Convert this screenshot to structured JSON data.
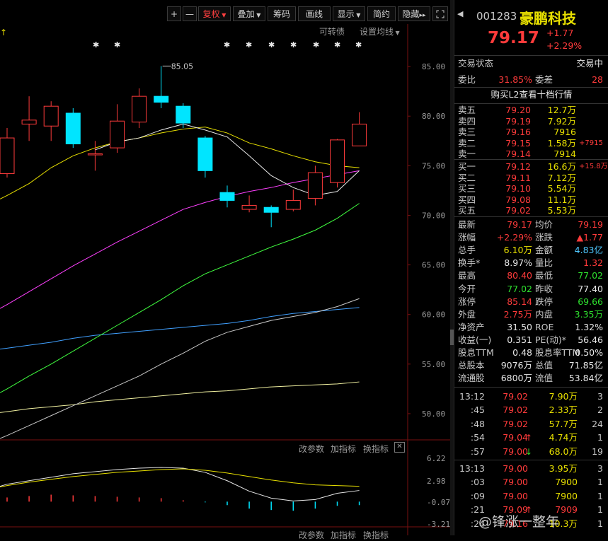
{
  "toolbar": {
    "plus": "+",
    "minus": "—",
    "fuquan": "复权",
    "diejia": "叠加",
    "chouma": "筹码",
    "huaxian": "画线",
    "xianshi": "显示",
    "jianyue": "简约",
    "yincang": "隐藏",
    "expand_icon": "expand-icon"
  },
  "chart": {
    "convertible": "可转债",
    "ma_settings": "设置均线",
    "high_marker": "85.05",
    "y_axis": [
      "85.00",
      "80.00",
      "75.00",
      "70.00",
      "65.00",
      "60.00",
      "55.00",
      "50.00"
    ],
    "sub_params": "改参数",
    "sub_add": "加指标",
    "sub_switch": "换指标",
    "sub_y_axis": [
      "6.22",
      "2.98",
      "-0.07",
      "-3.21"
    ],
    "bottom_params": "改参数",
    "bottom_add": "加指标",
    "bottom_switch": "换指标",
    "colors": {
      "up": "#ff3b3b",
      "down": "#00e5ff",
      "ma5": "#e8e8e8",
      "ma10": "#e8e000",
      "ma20": "#ff40ff",
      "ma30": "#40ff40",
      "ma60": "#c8c8c8",
      "ma120": "#40a0ff",
      "ma250": "#f0f0a0"
    }
  },
  "chart_data": {
    "type": "candlestick",
    "y_range": [
      47.5,
      88.5
    ],
    "candles": [
      {
        "o": 74.2,
        "c": 77.8,
        "h": 78.8,
        "l": 73.8
      },
      {
        "o": 79.2,
        "c": 79.6,
        "h": 82.0,
        "l": 77.5
      },
      {
        "o": 79.0,
        "c": 81.0,
        "h": 81.5,
        "l": 77.5
      },
      {
        "o": 80.3,
        "c": 77.2,
        "h": 80.8,
        "l": 76.8
      },
      {
        "o": 76.2,
        "c": 76.2,
        "h": 77.5,
        "l": 74.5
      },
      {
        "o": 76.8,
        "c": 79.5,
        "h": 81.2,
        "l": 76.3
      },
      {
        "o": 79.4,
        "c": 82.0,
        "h": 82.8,
        "l": 78.8
      },
      {
        "o": 82.0,
        "c": 81.4,
        "h": 85.05,
        "l": 80.8
      },
      {
        "o": 81.0,
        "c": 79.3,
        "h": 81.3,
        "l": 78.8
      },
      {
        "o": 77.8,
        "c": 74.5,
        "h": 78.0,
        "l": 73.8
      },
      {
        "o": 72.3,
        "c": 71.5,
        "h": 73.0,
        "l": 70.8
      },
      {
        "o": 70.6,
        "c": 71.0,
        "h": 72.0,
        "l": 70.3
      },
      {
        "o": 70.8,
        "c": 70.3,
        "h": 71.0,
        "l": 68.8
      },
      {
        "o": 70.6,
        "c": 71.5,
        "h": 72.6,
        "l": 70.4
      },
      {
        "o": 71.7,
        "c": 74.3,
        "h": 75.0,
        "l": 71.0
      },
      {
        "o": 73.3,
        "c": 77.6,
        "h": 77.7,
        "l": 72.8
      },
      {
        "o": 77.0,
        "c": 79.2,
        "h": 80.4,
        "l": 77.0
      }
    ],
    "ma5": [
      null,
      null,
      null,
      null,
      76.6,
      77.4,
      77.8,
      78.6,
      79.2,
      78.6,
      77.9,
      76.0,
      74.0,
      72.8,
      72.0,
      72.4,
      74.5
    ],
    "ma10": [
      72.0,
      73.2,
      74.8,
      76.0,
      76.8,
      77.4,
      77.8,
      78.3,
      78.7,
      78.9,
      78.3,
      77.3,
      76.7,
      76.0,
      75.4,
      75.0,
      74.8
    ],
    "ma20": [
      61.0,
      62.3,
      63.6,
      64.9,
      66.1,
      67.3,
      68.4,
      69.5,
      70.6,
      71.3,
      71.9,
      72.4,
      72.8,
      73.3,
      73.7,
      74.1,
      74.5
    ],
    "ma30": [
      52.5,
      53.8,
      55.0,
      56.3,
      57.6,
      58.9,
      60.2,
      61.5,
      62.9,
      64.1,
      65.0,
      65.9,
      66.8,
      67.6,
      68.5,
      69.7,
      71.2
    ],
    "ma60": [
      47.8,
      48.8,
      49.8,
      50.8,
      51.8,
      52.8,
      53.8,
      55.0,
      56.1,
      57.3,
      58.2,
      58.8,
      59.4,
      59.8,
      60.2,
      60.8,
      61.6
    ],
    "ma120": [
      56.6,
      56.9,
      57.2,
      57.6,
      57.9,
      58.1,
      58.3,
      58.5,
      58.7,
      58.9,
      59.1,
      59.4,
      59.8,
      60.1,
      60.3,
      60.5,
      60.7
    ],
    "ma250": [
      50.2,
      50.5,
      50.7,
      50.9,
      51.2,
      51.4,
      51.6,
      51.8,
      52.0,
      52.2,
      52.3,
      52.5,
      52.7,
      52.8,
      52.9,
      53.0,
      53.2
    ],
    "sub_range": [
      -3.21,
      6.22
    ],
    "dif": [
      2.5,
      3.0,
      3.5,
      4.0,
      4.3,
      4.6,
      4.8,
      4.9,
      4.8,
      4.2,
      3.0,
      1.5,
      0.5,
      0.1,
      0.3,
      1.2,
      1.6
    ],
    "dea": [
      2.3,
      2.8,
      3.2,
      3.6,
      3.9,
      4.2,
      4.4,
      4.6,
      4.7,
      4.5,
      4.1,
      3.6,
      3.1,
      2.7,
      2.4,
      2.3,
      2.2
    ],
    "macd": [
      0.6,
      0.8,
      1.0,
      0.9,
      0.8,
      0.7,
      0.6,
      0.5,
      0.2,
      -0.1,
      -0.5,
      -1.0,
      -1.2,
      -1.3,
      -1.0,
      -0.6,
      -0.5
    ]
  },
  "panel": {
    "code": "001283",
    "name": "豪鹏科技",
    "price": "79.17",
    "change": "+1.77",
    "change_pct": "+2.29%",
    "status_label": "交易状态",
    "status_value": "交易中",
    "weibi_label": "委比",
    "weibi_value": "31.85%",
    "weicha_label": "委差",
    "weicha_value": "28",
    "l2_banner": "购买L2查看十档行情",
    "sells": [
      {
        "label": "卖五",
        "price": "79.20",
        "vol": "12.7万",
        "extra": ""
      },
      {
        "label": "卖四",
        "price": "79.19",
        "vol": "7.92万",
        "extra": ""
      },
      {
        "label": "卖三",
        "price": "79.16",
        "vol": "7916",
        "extra": ""
      },
      {
        "label": "卖二",
        "price": "79.15",
        "vol": "1.58万",
        "extra": "+7915"
      },
      {
        "label": "卖一",
        "price": "79.14",
        "vol": "7914",
        "extra": ""
      }
    ],
    "buys": [
      {
        "label": "买一",
        "price": "79.12",
        "vol": "16.6万",
        "extra": "+15.8万"
      },
      {
        "label": "买二",
        "price": "79.11",
        "vol": "7.12万",
        "extra": ""
      },
      {
        "label": "买三",
        "price": "79.10",
        "vol": "5.54万",
        "extra": ""
      },
      {
        "label": "买四",
        "price": "79.08",
        "vol": "11.1万",
        "extra": ""
      },
      {
        "label": "买五",
        "price": "79.02",
        "vol": "5.53万",
        "extra": ""
      }
    ],
    "stats": [
      {
        "l1": "最新",
        "v1": "79.17",
        "c1": "red",
        "l2": "均价",
        "v2": "79.19",
        "c2": "red"
      },
      {
        "l1": "涨幅",
        "v1": "+2.29%",
        "c1": "red",
        "l2": "涨跌",
        "v2": "▲1.77",
        "c2": "red"
      },
      {
        "l1": "总手",
        "v1": "6.10万",
        "c1": "yel",
        "l2": "金额",
        "v2": "4.83亿",
        "c2": "cyan"
      },
      {
        "l1": "换手*",
        "v1": "8.97%",
        "c1": "white",
        "l2": "量比",
        "v2": "1.32",
        "c2": "red"
      },
      {
        "l1": "最高",
        "v1": "80.40",
        "c1": "red",
        "l2": "最低",
        "v2": "77.02",
        "c2": "green"
      },
      {
        "l1": "今开",
        "v1": "77.02",
        "c1": "green",
        "l2": "昨收",
        "v2": "77.40",
        "c2": "white"
      },
      {
        "l1": "涨停",
        "v1": "85.14",
        "c1": "red",
        "l2": "跌停",
        "v2": "69.66",
        "c2": "green"
      },
      {
        "l1": "外盘",
        "v1": "2.75万",
        "c1": "red",
        "l2": "内盘",
        "v2": "3.35万",
        "c2": "green"
      },
      {
        "l1": "净资产",
        "v1": "31.50",
        "c1": "white",
        "l2": "ROE",
        "v2": "1.32%",
        "c2": "white"
      },
      {
        "l1": "收益(一)",
        "v1": "0.351",
        "c1": "white",
        "l2": "PE(动)*",
        "v2": "56.46",
        "c2": "white"
      },
      {
        "l1": "股息TTM",
        "v1": "0.48",
        "c1": "white",
        "l2": "股息率TTM",
        "v2": "0.50%",
        "c2": "white"
      },
      {
        "l1": "总股本",
        "v1": "9076万",
        "c1": "white",
        "l2": "总值",
        "v2": "71.85亿",
        "c2": "white"
      },
      {
        "l1": "流通股",
        "v1": "6800万",
        "c1": "white",
        "l2": "流值",
        "v2": "53.84亿",
        "c2": "white"
      }
    ],
    "ticks": [
      {
        "t": "13:12",
        "p": "79.02",
        "pc": "red",
        "v": "7.90万",
        "vc": "yel",
        "arrow": "",
        "n": "3"
      },
      {
        "t": ":45",
        "p": "79.02",
        "pc": "red",
        "v": "2.33万",
        "vc": "yel",
        "arrow": "",
        "n": "2"
      },
      {
        "t": ":48",
        "p": "79.02",
        "pc": "red",
        "v": "57.7万",
        "vc": "yel",
        "arrow": "",
        "n": "24"
      },
      {
        "t": ":54",
        "p": "79.04",
        "pc": "red",
        "v": "4.74万",
        "vc": "yel",
        "arrow": "up",
        "n": "1"
      },
      {
        "t": ":57",
        "p": "79.00",
        "pc": "red",
        "v": "68.0万",
        "vc": "yel",
        "arrow": "down",
        "n": "19"
      },
      {
        "t": "13:13",
        "p": "79.00",
        "pc": "red",
        "v": "3.95万",
        "vc": "yel",
        "arrow": "",
        "n": "3"
      },
      {
        "t": ":03",
        "p": "79.00",
        "pc": "red",
        "v": "7900",
        "vc": "yel",
        "arrow": "",
        "n": "1"
      },
      {
        "t": ":09",
        "p": "79.00",
        "pc": "red",
        "v": "7900",
        "vc": "yel",
        "arrow": "",
        "n": "1"
      },
      {
        "t": ":21",
        "p": "79.09",
        "pc": "red",
        "v": "7909",
        "vc": "red",
        "arrow": "up",
        "n": "1"
      },
      {
        "t": ":24",
        "p": "79.16",
        "pc": "red",
        "v": "10.3万",
        "vc": "yel",
        "arrow": "",
        "n": "1"
      }
    ]
  },
  "watermark": "@锋涨一整年"
}
